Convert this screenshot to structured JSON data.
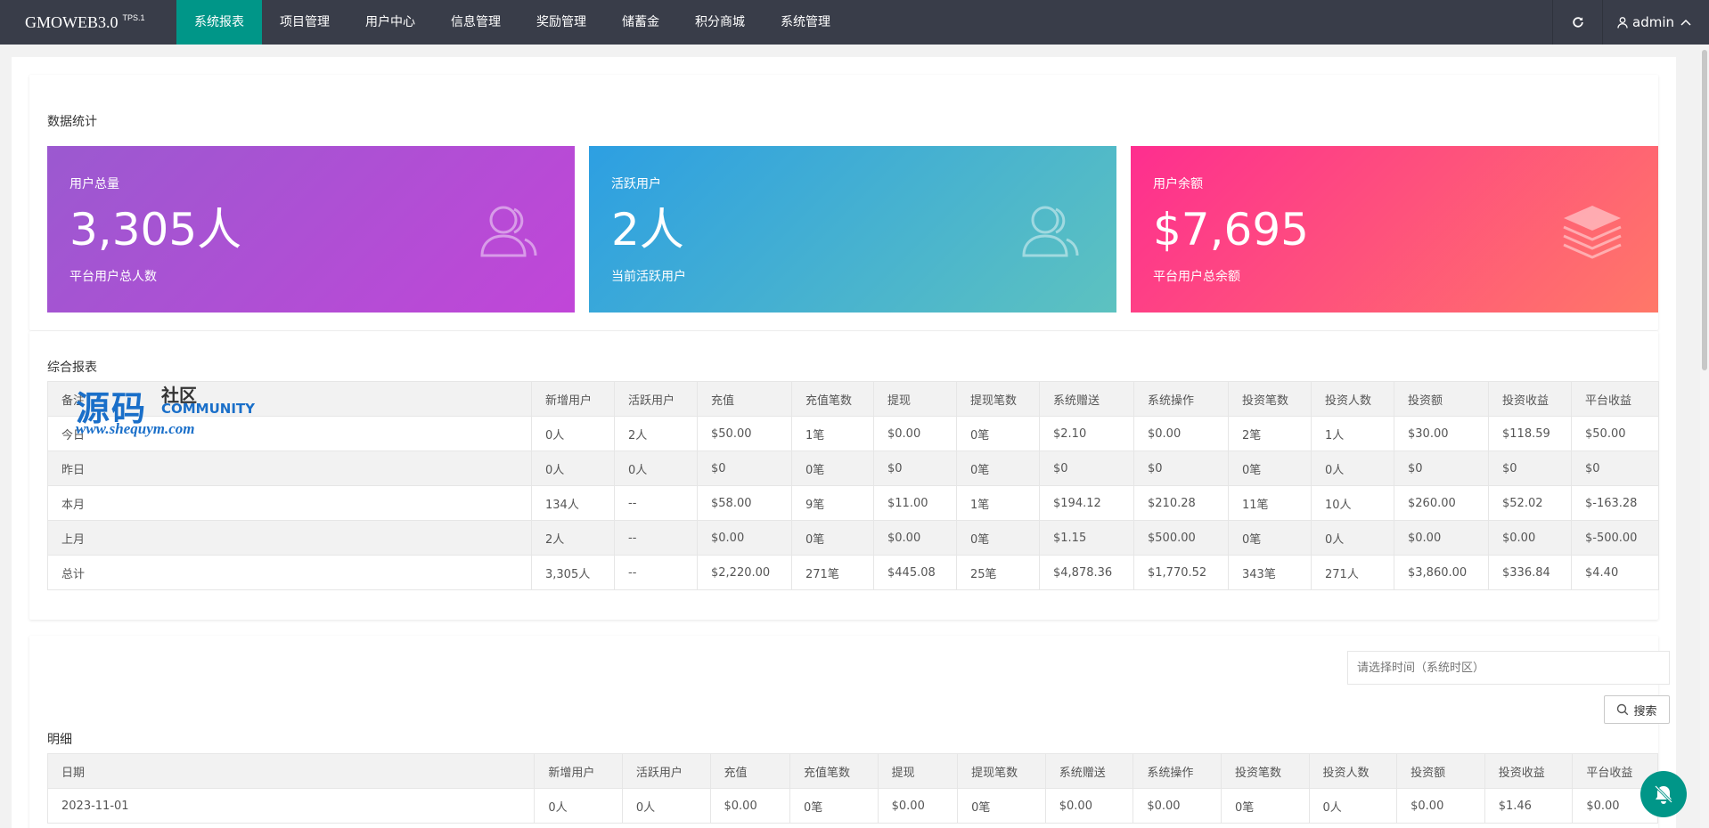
{
  "app": {
    "brand": "GMOWEB3.0",
    "version": "TPS.1"
  },
  "nav": {
    "items": [
      {
        "label": "系统报表"
      },
      {
        "label": "项目管理"
      },
      {
        "label": "用户中心"
      },
      {
        "label": "信息管理"
      },
      {
        "label": "奖励管理"
      },
      {
        "label": "储蓄金"
      },
      {
        "label": "积分商城"
      },
      {
        "label": "系统管理"
      }
    ],
    "active_index": 0
  },
  "header": {
    "user": "admin",
    "refresh_icon": "refresh-icon",
    "user_icon": "user-icon"
  },
  "stats": {
    "title": "数据统计",
    "cards": [
      {
        "label": "用户总量",
        "value": "3,305人",
        "sub": "平台用户总人数",
        "icon": "users-icon",
        "gradient": [
          "#9b59d0",
          "#c146d8"
        ]
      },
      {
        "label": "活跃用户",
        "value": "2人",
        "sub": "当前活跃用户",
        "icon": "users-icon",
        "gradient": [
          "#2d9fe2",
          "#5dc2c0"
        ]
      },
      {
        "label": "用户余额",
        "value": "$7,695",
        "sub": "平台用户总余额",
        "icon": "layers-icon",
        "gradient": [
          "#fe2e8f",
          "#ff7868"
        ]
      }
    ]
  },
  "summary": {
    "title": "综合报表",
    "columns": [
      "备注",
      "新增用户",
      "活跃用户",
      "充值",
      "充值笔数",
      "提现",
      "提现笔数",
      "系统赠送",
      "系统操作",
      "投资笔数",
      "投资人数",
      "投资额",
      "投资收益",
      "平台收益"
    ],
    "rows": [
      [
        "今日",
        "0人",
        "2人",
        "$50.00",
        "1笔",
        "$0.00",
        "0笔",
        "$2.10",
        "$0.00",
        "2笔",
        "1人",
        "$30.00",
        "$118.59",
        "$50.00"
      ],
      [
        "昨日",
        "0人",
        "0人",
        "$0",
        "0笔",
        "$0",
        "0笔",
        "$0",
        "$0",
        "0笔",
        "0人",
        "$0",
        "$0",
        "$0"
      ],
      [
        "本月",
        "134人",
        "--",
        "$58.00",
        "9笔",
        "$11.00",
        "1笔",
        "$194.12",
        "$210.28",
        "11笔",
        "10人",
        "$260.00",
        "$52.02",
        "$-163.28"
      ],
      [
        "上月",
        "2人",
        "--",
        "$0.00",
        "0笔",
        "$0.00",
        "0笔",
        "$1.15",
        "$500.00",
        "0笔",
        "0人",
        "$0.00",
        "$0.00",
        "$-500.00"
      ],
      [
        "总计",
        "3,305人",
        "--",
        "$2,220.00",
        "271笔",
        "$445.08",
        "25笔",
        "$4,878.36",
        "$1,770.52",
        "343笔",
        "271人",
        "$3,860.00",
        "$336.84",
        "$4.40"
      ]
    ]
  },
  "detail": {
    "title": "明细",
    "date_placeholder": "请选择时间（系统时区）",
    "search_label": "搜索",
    "columns": [
      "日期",
      "新增用户",
      "活跃用户",
      "充值",
      "充值笔数",
      "提现",
      "提现笔数",
      "系统赠送",
      "系统操作",
      "投资笔数",
      "投资人数",
      "投资额",
      "投资收益",
      "平台收益"
    ],
    "rows": [
      [
        "2023-11-01",
        "0人",
        "0人",
        "$0.00",
        "0笔",
        "$0.00",
        "0笔",
        "$0.00",
        "$0.00",
        "0笔",
        "0人",
        "$0.00",
        "$1.46",
        "$0.00"
      ]
    ]
  },
  "watermark": {
    "big": "源码",
    "small": "社区",
    "community": "COMMUNITY",
    "url": "www.shequym.com"
  }
}
